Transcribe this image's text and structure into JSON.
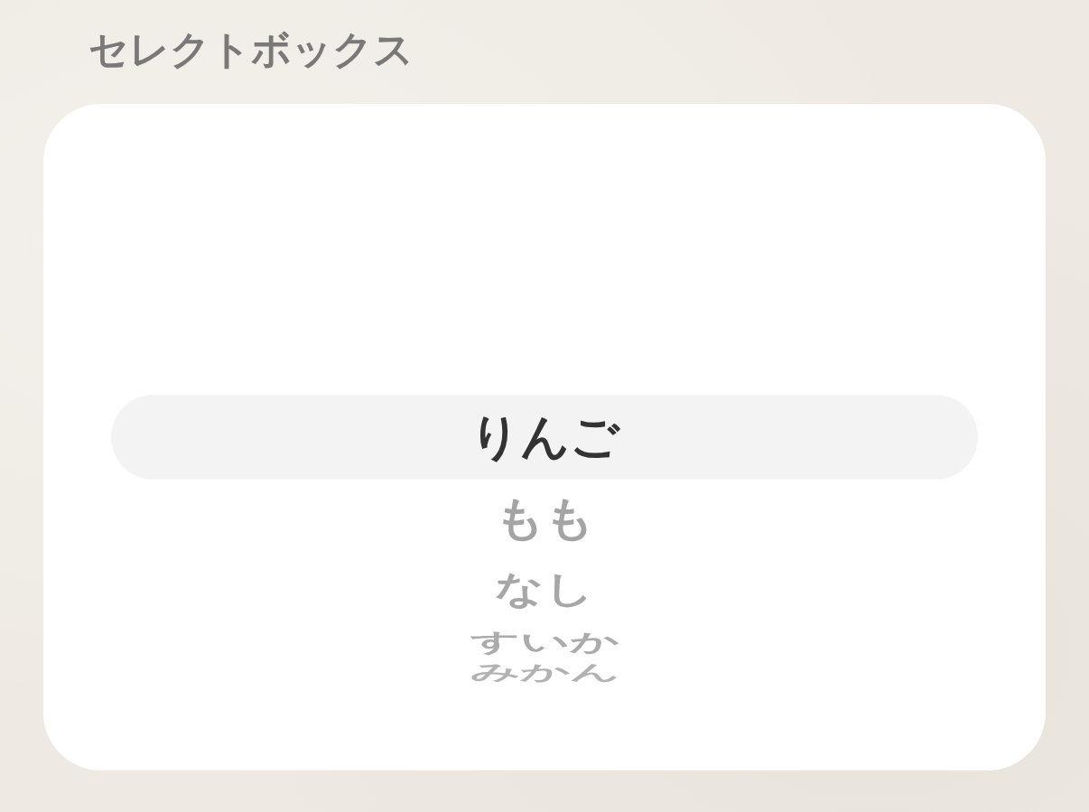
{
  "title": "セレクトボックス",
  "picker": {
    "options": [
      {
        "label": "りんご",
        "selected": true
      },
      {
        "label": "もも",
        "selected": false
      },
      {
        "label": "なし",
        "selected": false
      },
      {
        "label": "すいか",
        "selected": false
      },
      {
        "label": "みかん",
        "selected": false
      }
    ]
  }
}
